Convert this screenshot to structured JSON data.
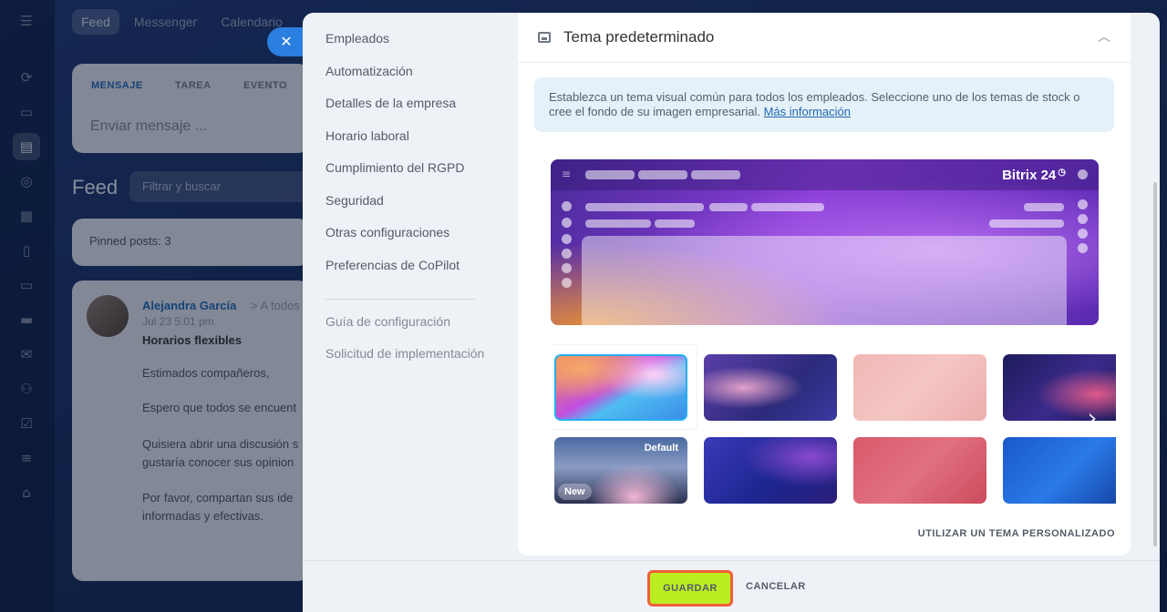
{
  "background": {
    "top_tabs": [
      "Feed",
      "Messenger",
      "Calendario"
    ],
    "post_tabs": [
      "MENSAJE",
      "TAREA",
      "EVENTO"
    ],
    "message_placeholder": "Enviar mensaje ...",
    "feed_title": "Feed",
    "filter_placeholder": "Filtrar y buscar",
    "pinned": "Pinned posts: 3",
    "post": {
      "author": "Alejandra García",
      "recipient": "> A todos l",
      "date": "Jul 23 5:01 pm",
      "title": "Horarios flexibles",
      "lines": [
        "Estimados compañeros,",
        "Espero que todos se encuent",
        "Quisiera abrir una discusión s",
        "gustaría conocer sus opinion",
        "Por favor, compartan sus ide",
        "informadas y efectivas."
      ]
    },
    "close_icon": "close-icon"
  },
  "settings_nav": {
    "items": [
      "Empleados",
      "Automatización",
      "Detalles de la empresa",
      "Horario laboral",
      "Cumplimiento del RGPD",
      "Seguridad",
      "Otras configuraciones",
      "Preferencias de CoPilot"
    ],
    "secondary": [
      "Guía de configuración",
      "Solicitud de implementación"
    ]
  },
  "section": {
    "title": "Tema predeterminado",
    "info_text": "Establezca un tema visual común para todos los empleados. Seleccione uno de los temas de stock o cree el fondo de su imagen empresarial.",
    "info_link": "Más información",
    "brand": "Bitrix 24",
    "custom_theme_link": "UTILIZAR UN TEMA PERSONALIZADO",
    "thumb_badges": {
      "default": "Default",
      "new": "New"
    }
  },
  "footer": {
    "save": "GUARDAR",
    "cancel": "CANCELAR"
  },
  "colors": {
    "save_button": "#bbed21",
    "save_outline": "#f25d3c",
    "selected_thumb_border": "#25aef0",
    "link": "#2067b0"
  }
}
